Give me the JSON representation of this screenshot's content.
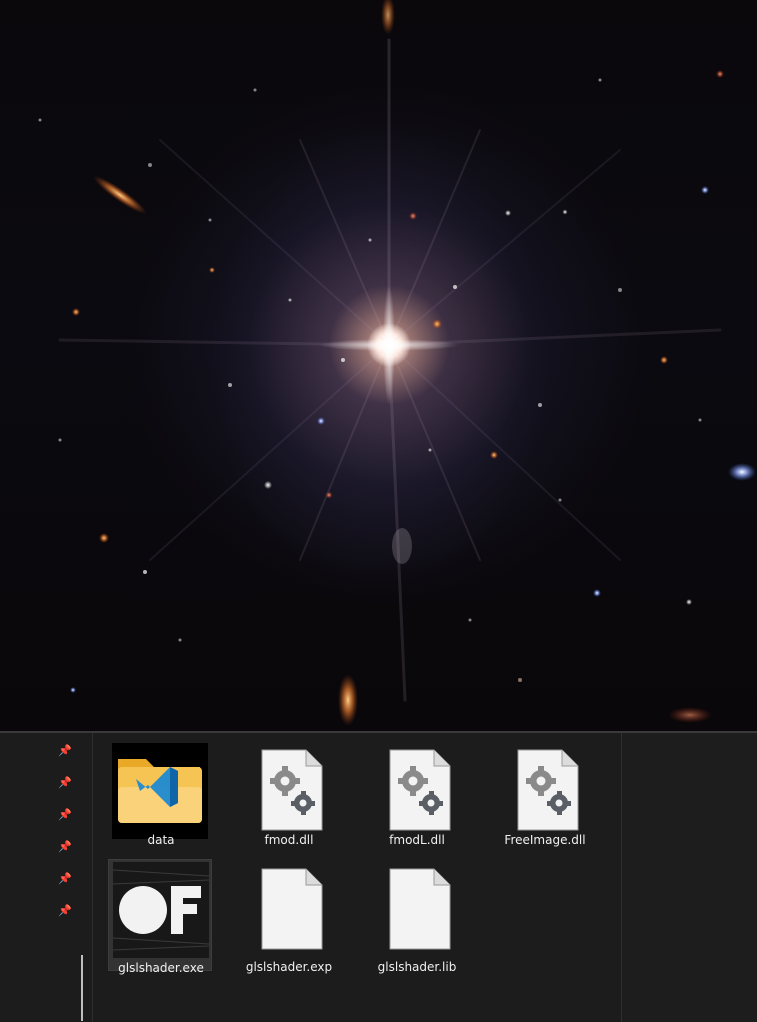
{
  "files": [
    {
      "name": "data",
      "icon": "vscode-folder-icon",
      "selected": false
    },
    {
      "name": "fmod.dll",
      "icon": "dll-gear-icon",
      "selected": false
    },
    {
      "name": "fmodL.dll",
      "icon": "dll-gear-icon",
      "selected": false
    },
    {
      "name": "FreeImage.dll",
      "icon": "dll-gear-icon",
      "selected": false
    },
    {
      "name": "glslshader.exe",
      "icon": "openframeworks-app-icon",
      "selected": true
    },
    {
      "name": "glslshader.exp",
      "icon": "blank-file-icon",
      "selected": false
    },
    {
      "name": "glslshader.lib",
      "icon": "blank-file-icon",
      "selected": false
    }
  ],
  "nav_pins": [
    "pin-icon",
    "pin-icon",
    "pin-icon",
    "pin-icon",
    "pin-icon",
    "pin-icon"
  ],
  "app_logo": "OF",
  "colors": {
    "panel": "#1c1c1c",
    "selected": "#333333",
    "folder": "#f5c14a",
    "vscode_blue": "#1f8ad2"
  }
}
